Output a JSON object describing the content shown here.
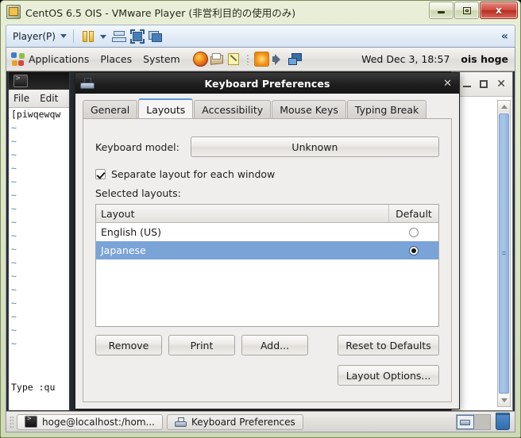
{
  "window": {
    "title": "CentOS 6.5 OIS - VMware Player (非営利目的の使用のみ)",
    "app_icon": "vmware-icon",
    "controls": {
      "minimize": "minimize-icon",
      "maximize": "maximize-icon",
      "close": "x"
    }
  },
  "vmware_toolbar": {
    "player_menu": "Player(P)",
    "dropdown_caret": "caret-down-icon",
    "icons": [
      {
        "name": "suspend-icon"
      },
      {
        "name": "suspend-dropdown-caret-icon"
      },
      {
        "name": "removable-devices-icon"
      },
      {
        "name": "enter-fullscreen-icon"
      },
      {
        "name": "unity-mode-icon"
      }
    ],
    "expander": "«"
  },
  "gnome_panel": {
    "app_icon": "gnome-foot-icon",
    "menus": [
      "Applications",
      "Places",
      "System"
    ],
    "launchers": [
      {
        "name": "firefox-icon"
      },
      {
        "name": "evolution-mail-icon"
      },
      {
        "name": "text-editor-icon"
      }
    ],
    "tray": [
      {
        "name": "brightness-icon"
      },
      {
        "name": "volume-icon"
      },
      {
        "name": "network-icon"
      }
    ],
    "clock": "Wed Dec  3, 18:57",
    "user": "ois hoge"
  },
  "terminal_window": {
    "icon": "terminal-icon",
    "menus": [
      "File",
      "Edit"
    ],
    "prompt_line": "[piwqewqw",
    "tilde_char": "~",
    "tilde_count": 17,
    "status_line": "Type   :qu"
  },
  "background_window": {
    "controls": {
      "minimize": "minimize-icon",
      "maximize": "maximize-icon",
      "close": "✕"
    },
    "scrollbar": {
      "up_arrow": "scroll-up-icon",
      "down_arrow": "scroll-down-icon",
      "thumb": "scrollbar-thumb"
    }
  },
  "keyboard_dialog": {
    "icon": "keyboard-icon",
    "title": "Keyboard Preferences",
    "close": "✕",
    "tabs": [
      {
        "label": "General",
        "active": false
      },
      {
        "label": "Layouts",
        "active": true
      },
      {
        "label": "Accessibility",
        "active": false
      },
      {
        "label": "Mouse Keys",
        "active": false
      },
      {
        "label": "Typing Break",
        "active": false
      }
    ],
    "keyboard_model_label": "Keyboard model:",
    "keyboard_model_value": "Unknown",
    "separate_layout_label": "Separate layout for each window",
    "separate_layout_checked": true,
    "selected_layouts_label": "Selected layouts:",
    "list": {
      "headers": [
        "Layout",
        "Default"
      ],
      "rows": [
        {
          "layout": "English (US)",
          "default": false,
          "selected": false
        },
        {
          "layout": "Japanese",
          "default": true,
          "selected": true
        }
      ]
    },
    "buttons": {
      "remove": "Remove",
      "print": "Print",
      "add": "Add...",
      "reset": "Reset to Defaults",
      "layout_options": "Layout Options..."
    },
    "selection_color": "#7aa3d8"
  },
  "taskbar": {
    "items": [
      {
        "label": "hoge@localhost:/hom...",
        "icon": "terminal-icon",
        "active": false
      },
      {
        "label": "Keyboard Preferences",
        "icon": "keyboard-icon",
        "active": true
      }
    ],
    "workspace_switcher": "workspace-switcher",
    "trash": "trash-icon"
  }
}
